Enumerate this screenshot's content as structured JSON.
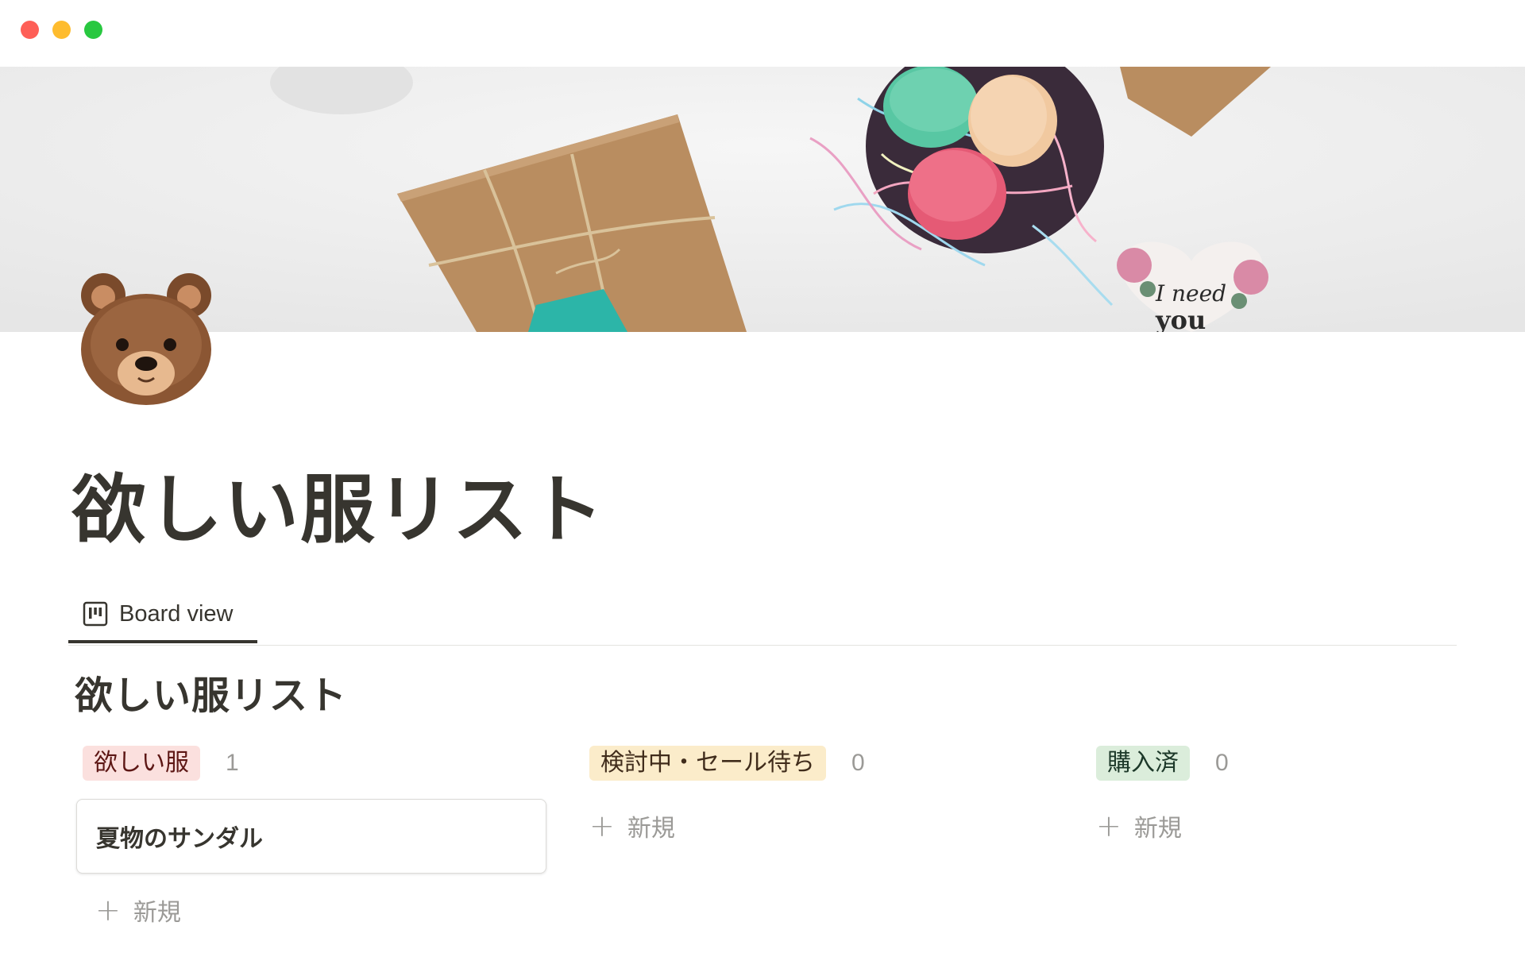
{
  "page": {
    "title": "欲しい服リスト",
    "icon": "bear-emoji-icon"
  },
  "view": {
    "tab_label": "Board view",
    "tab_icon": "board-icon"
  },
  "board": {
    "title": "欲しい服リスト",
    "columns": [
      {
        "label": "欲しい服",
        "count": "1",
        "tag_bg": "#fbe0de",
        "tag_fg": "#5d1715",
        "cards": [
          {
            "title": "夏物のサンダル"
          }
        ],
        "new_label": "新規"
      },
      {
        "label": "検討中・セール待ち",
        "count": "0",
        "tag_bg": "#fbecca",
        "tag_fg": "#402c1b",
        "cards": [],
        "new_label": "新規"
      },
      {
        "label": "購入済",
        "count": "0",
        "tag_bg": "#dbeddb",
        "tag_fg": "#1c3829",
        "cards": [],
        "new_label": "新規"
      }
    ]
  },
  "colors": {
    "text": "#37352f",
    "muted": "#9b9a97"
  }
}
